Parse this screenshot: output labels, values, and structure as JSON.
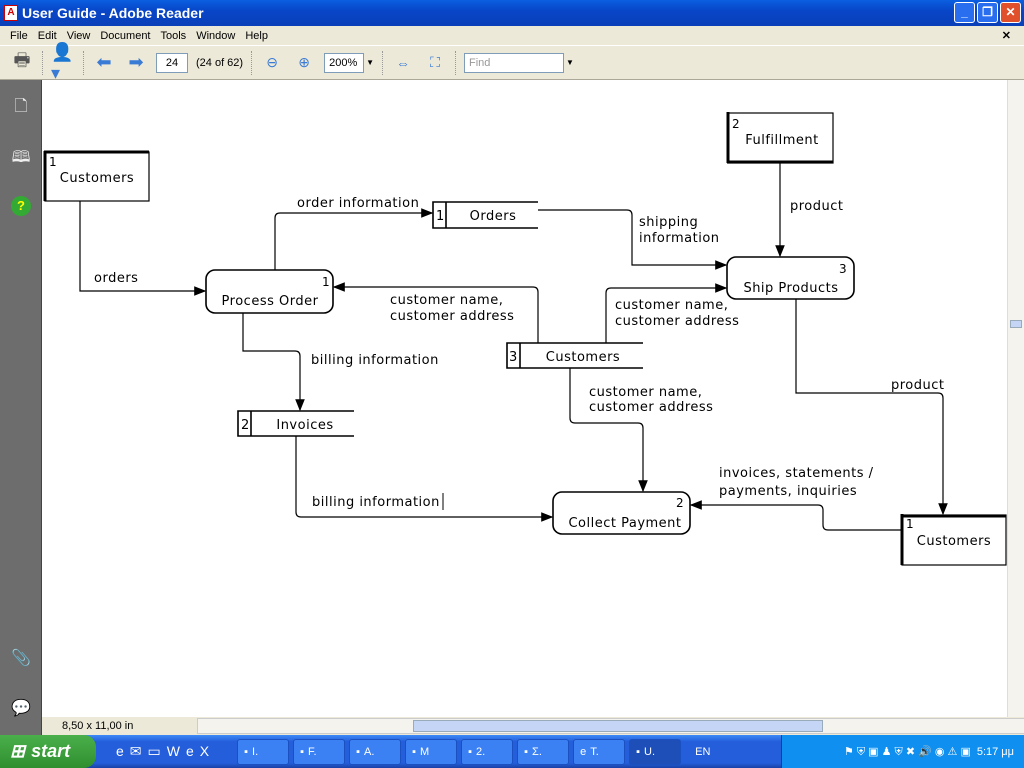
{
  "window": {
    "title": "User Guide - Adobe Reader"
  },
  "menu": [
    "File",
    "Edit",
    "View",
    "Document",
    "Tools",
    "Window",
    "Help"
  ],
  "toolbar": {
    "page": "24",
    "page_of": "(24 of 62)",
    "zoom": "200%",
    "find_placeholder": "Find"
  },
  "status": {
    "page_size": "8,50 x 11,00 in"
  },
  "diagram": {
    "entities": [
      {
        "num": "1",
        "label": "Customers"
      },
      {
        "num": "2",
        "label": "Fulfillment"
      },
      {
        "num": "1",
        "label": "Customers"
      }
    ],
    "processes": [
      {
        "num": "1",
        "label": "Process Order"
      },
      {
        "num": "3",
        "label": "Ship Products"
      },
      {
        "num": "2",
        "label": "Collect Payment"
      }
    ],
    "stores": [
      {
        "num": "1",
        "label": "Orders"
      },
      {
        "num": "3",
        "label": "Customers"
      },
      {
        "num": "2",
        "label": "Invoices"
      }
    ],
    "flows": {
      "orders": "orders",
      "order_info": "order information",
      "shipping1": "shipping",
      "shipping2": "information",
      "product1": "product",
      "cust1a": "customer name,",
      "cust1b": "customer address",
      "cust2a": "customer name,",
      "cust2b": "customer address",
      "billing1": "billing information",
      "cust3a": "customer name,",
      "cust3b": "customer address",
      "billing2": "billing information",
      "product2": "product",
      "inv1": "invoices, statements /",
      "inv2": "payments, inquiries"
    }
  },
  "taskbar": {
    "start": "start",
    "tasks": [
      "I.",
      "F.",
      "A.",
      "M",
      "2.",
      "Σ.",
      "T.",
      "U."
    ],
    "lang": "EN",
    "clock": "5:17 μμ"
  }
}
